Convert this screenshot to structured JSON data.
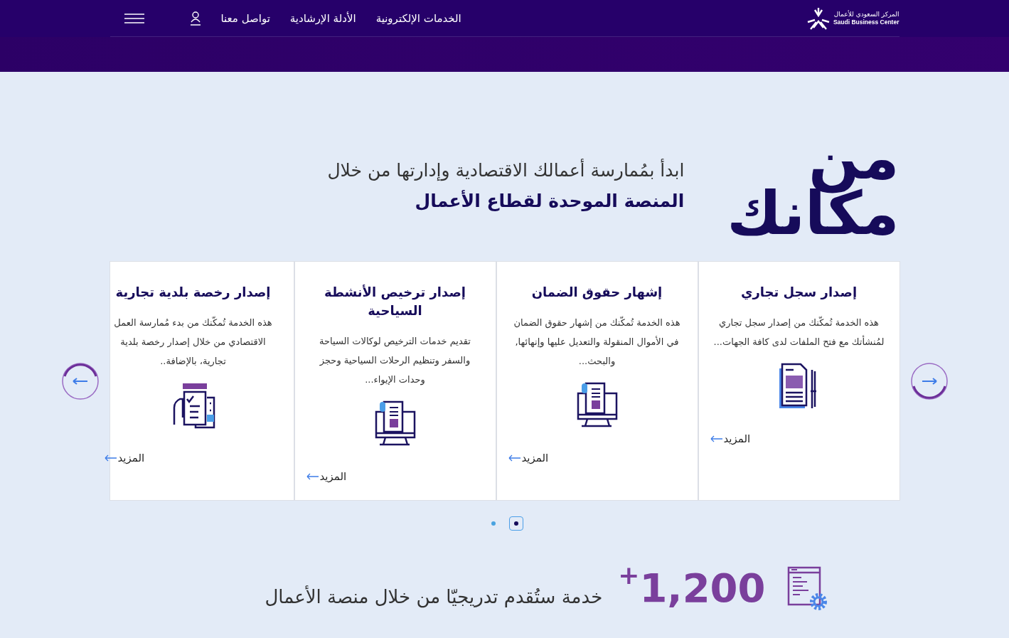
{
  "logo": {
    "arabic": "المركز السعودي للأعمال",
    "english": "Saudi Business Center"
  },
  "nav": [
    {
      "label": "الخدمات الإلكترونية"
    },
    {
      "label": "الأدلة الإرشادية"
    },
    {
      "label": "تواصل معنا"
    }
  ],
  "hero": {
    "title_lines": [
      "من",
      "مكانك"
    ],
    "subtitle": "ابدأ بمُمارسة أعمالك الاقتصادية وإدارتها من خلال",
    "tagline": "المنصة الموحدة لقطاع الأعمال"
  },
  "cards": [
    {
      "title": "إصدار سجل تجاري",
      "description": "هذه الخدمة تُمكّنك من إصدار سجل تجاري لمُنشأتك مع فتح الملفات لدى كافة الجهات...",
      "link": "المزيد"
    },
    {
      "title": "إشهار حقوق الضمان",
      "description": "هذه الخدمة تُمكّنك من إشهار حقوق الضمان في الأموال المنقولة والتعديل عليها وإنهائها, والبحث...",
      "link": "المزيد"
    },
    {
      "title": "إصدار ترخيص الأنشطة السياحية",
      "description": "تقديم خدمات الترخيص لوكالات السياحة والسفر وتنظيم الرحلات السياحية وحجز وحدات الإيواء...",
      "link": "المزيد"
    },
    {
      "title": "إصدار رخصة بلدية تجارية",
      "description": "هذه الخدمة تُمكّنك من بدء مُمارسة العمل الاقتصادي من خلال إصدار رخصة بلدية تجارية، بالإضافة..",
      "link": "المزيد"
    }
  ],
  "pagination": [
    {
      "selected": true
    },
    {
      "selected": false
    }
  ],
  "stats": {
    "number": "1,200",
    "plus": "+",
    "text": "خدمة ستُقدم تدريجيّا من خلال منصة الأعمال"
  }
}
